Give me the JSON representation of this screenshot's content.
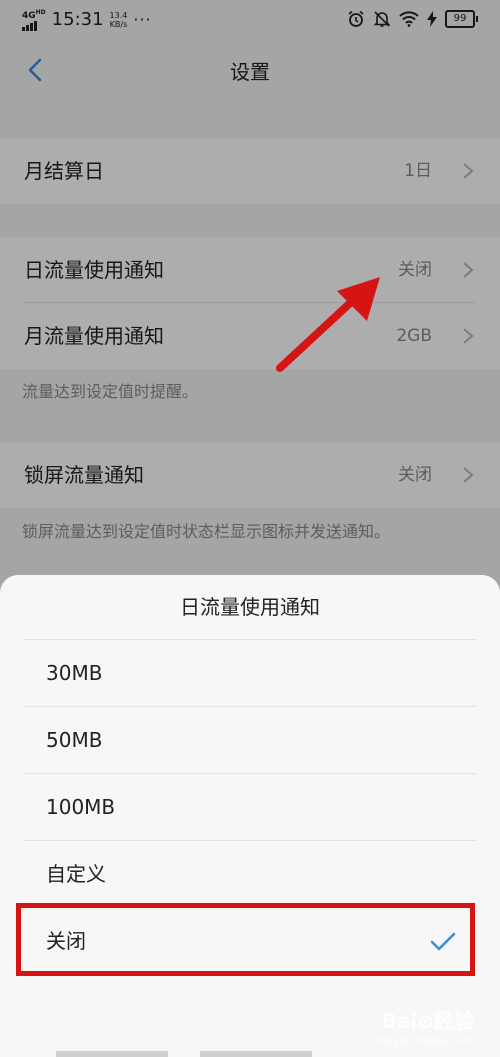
{
  "status_bar": {
    "network": "4G",
    "hd": "HD",
    "time": "15:31",
    "speed_value": "13.4",
    "speed_unit": "KB/s",
    "more": "···",
    "battery": "99"
  },
  "nav": {
    "title": "设置"
  },
  "settings": {
    "billing_day": {
      "label": "月结算日",
      "value": "1日"
    },
    "daily_notice": {
      "label": "日流量使用通知",
      "value": "关闭"
    },
    "monthly_notice": {
      "label": "月流量使用通知",
      "value": "2GB"
    },
    "traffic_hint": "流量达到设定值时提醒。",
    "lock_notice": {
      "label": "锁屏流量通知",
      "value": "关闭"
    },
    "lock_hint": "锁屏流量达到设定值时状态栏显示图标并发送通知。"
  },
  "sheet": {
    "title": "日流量使用通知",
    "options": [
      "30MB",
      "50MB",
      "100MB",
      "自定义",
      "关闭"
    ],
    "selected": "关闭"
  },
  "watermark": {
    "main": "Bai⊙经验",
    "sub": "jingyan.baidu.com"
  },
  "colors": {
    "accent": "#3a8fd9",
    "annotation": "#d71414"
  },
  "icons": {
    "back": "chevron-left-icon",
    "row_chevron": "chevron-right-icon",
    "check": "check-icon",
    "alarm": "alarm-icon",
    "mute": "bell-off-icon",
    "wifi": "wifi-icon",
    "charging": "bolt-icon",
    "battery": "battery-icon"
  }
}
